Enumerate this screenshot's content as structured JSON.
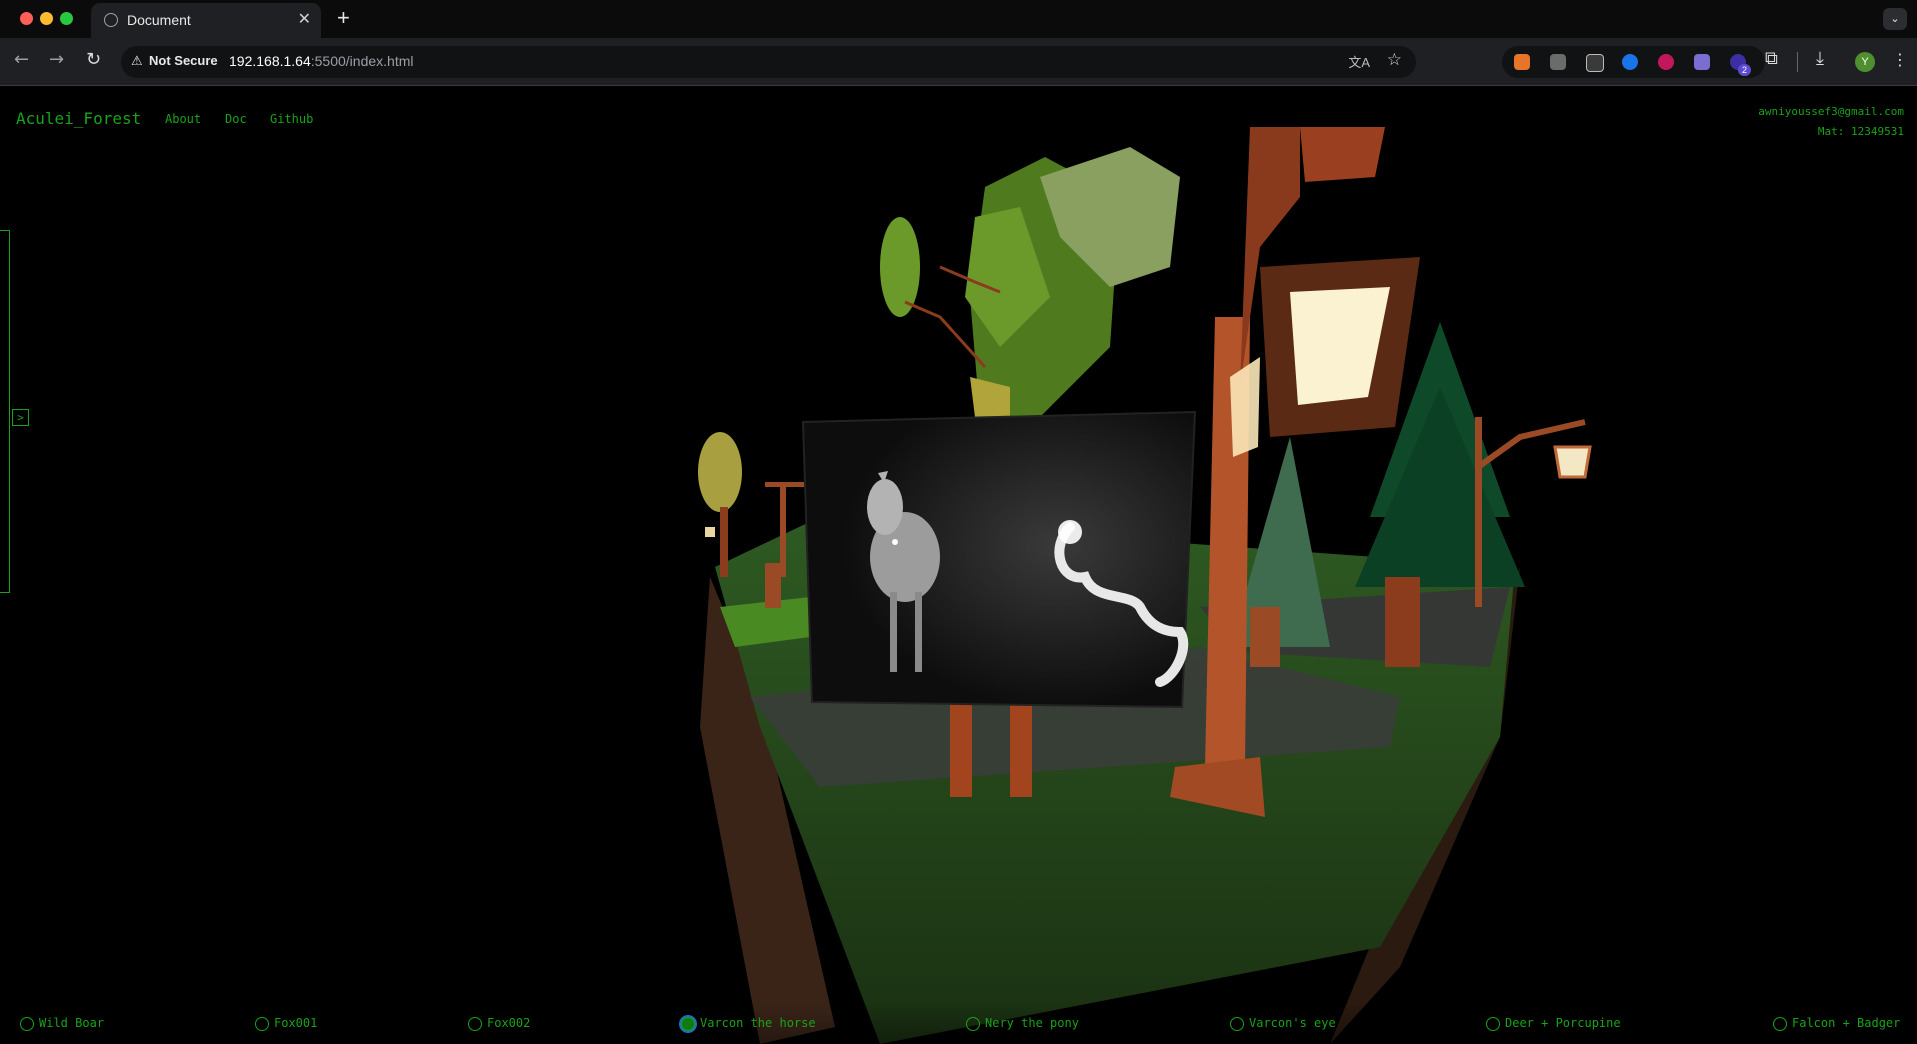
{
  "browser": {
    "tab_title": "Document",
    "new_tab": "+",
    "security_label": "Not Secure",
    "url_host": "192.168.1.64",
    "url_rest": ":5500/index.html",
    "profile_initial": "Y",
    "extension_badge": "2"
  },
  "site": {
    "brand": "Aculei_Forest",
    "nav": [
      {
        "label": "About"
      },
      {
        "label": "Doc"
      },
      {
        "label": "Github"
      }
    ],
    "user": {
      "email": "awniyoussef3@gmail.com",
      "mat": "Mat: 12349531"
    },
    "side_toggle": ">"
  },
  "gallery": {
    "items": [
      {
        "label": "Wild Boar",
        "selected": false
      },
      {
        "label": "Fox001",
        "selected": false
      },
      {
        "label": "Fox002",
        "selected": false
      },
      {
        "label": "Varcon the horse",
        "selected": true
      },
      {
        "label": "Nery the pony",
        "selected": false
      },
      {
        "label": "Varcon's eye",
        "selected": false
      },
      {
        "label": "Deer + Porcupine",
        "selected": false
      },
      {
        "label": "Falcon + Badger",
        "selected": false
      }
    ]
  },
  "colors": {
    "accent": "#19a319",
    "background": "#000000",
    "selected_ring": "#1f6bc9"
  }
}
